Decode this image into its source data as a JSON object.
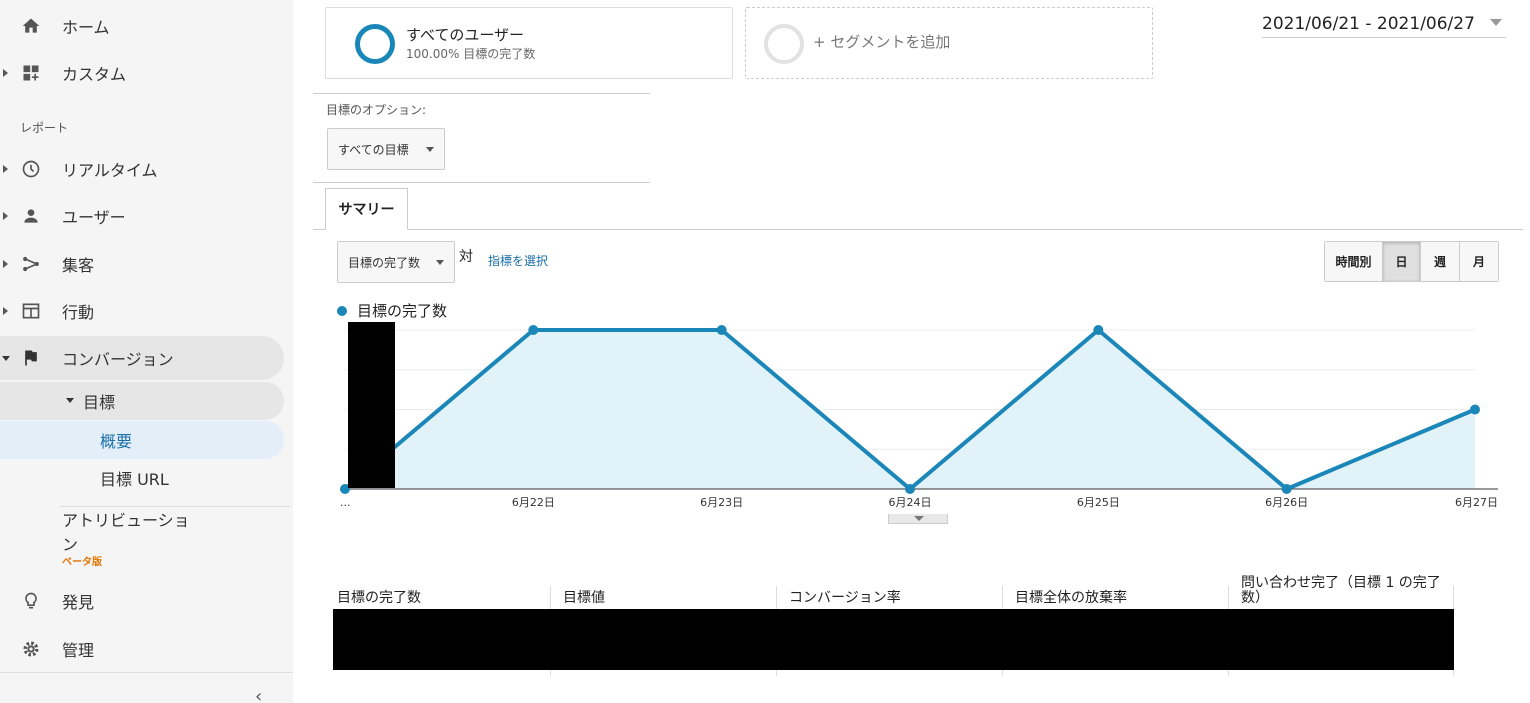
{
  "sidebar": {
    "items_top": [
      {
        "label": "ホーム",
        "icon": "home-icon"
      },
      {
        "label": "カスタム",
        "icon": "dashboard-plus-icon"
      }
    ],
    "section_reports": "レポート",
    "items_reports": [
      {
        "label": "リアルタイム",
        "icon": "clock-icon"
      },
      {
        "label": "ユーザー",
        "icon": "person-icon"
      },
      {
        "label": "集客",
        "icon": "acquisition-icon"
      },
      {
        "label": "行動",
        "icon": "behavior-window-icon"
      },
      {
        "label": "コンバージョン",
        "icon": "flag-icon"
      }
    ],
    "conversion_sub": {
      "goals": "目標",
      "overview": "概要",
      "goal_urls": "目標 URL"
    },
    "attribution_line1": "アトリビューショ",
    "attribution_line2": "ン",
    "beta": "ベータ版",
    "discover": "発見",
    "admin": "管理",
    "collapse_icon": "‹"
  },
  "segments": {
    "all_users": {
      "name": "すべてのユーザー",
      "sub": "100.00% 目標の完了数"
    },
    "add_segment": "+ セグメントを追加"
  },
  "date_range": "2021/06/21 - 2021/06/27",
  "goal_options": {
    "label": "目標のオプション:",
    "selected": "すべての目標"
  },
  "tabs": {
    "summary": "サマリー"
  },
  "metric_bar": {
    "metric_selected": "目標の完了数",
    "vs": "対",
    "select_metric": "指標を選択"
  },
  "period_buttons": [
    {
      "label": "時間別",
      "active": false
    },
    {
      "label": "日",
      "active": true
    },
    {
      "label": "週",
      "active": false
    },
    {
      "label": "月",
      "active": false
    }
  ],
  "chart_data": {
    "type": "area",
    "series": [
      {
        "name": "目標の完了数",
        "values": [
          0,
          4,
          4,
          0,
          4,
          0,
          2
        ]
      }
    ],
    "categories": [
      "...",
      "6月22日",
      "6月23日",
      "6月24日",
      "6月25日",
      "6月26日",
      "6月27日"
    ],
    "ylim": [
      0,
      4
    ],
    "grid": true,
    "legend": "top-left",
    "color": "#1a87b8",
    "fill": "#e1f2f9"
  },
  "scorecards": [
    {
      "label": "目標の完了数"
    },
    {
      "label": "目標値"
    },
    {
      "label": "コンバージョン率"
    },
    {
      "label": "目標全体の放棄率"
    },
    {
      "label": "問い合わせ完了（目標 1 の完了数）"
    }
  ]
}
